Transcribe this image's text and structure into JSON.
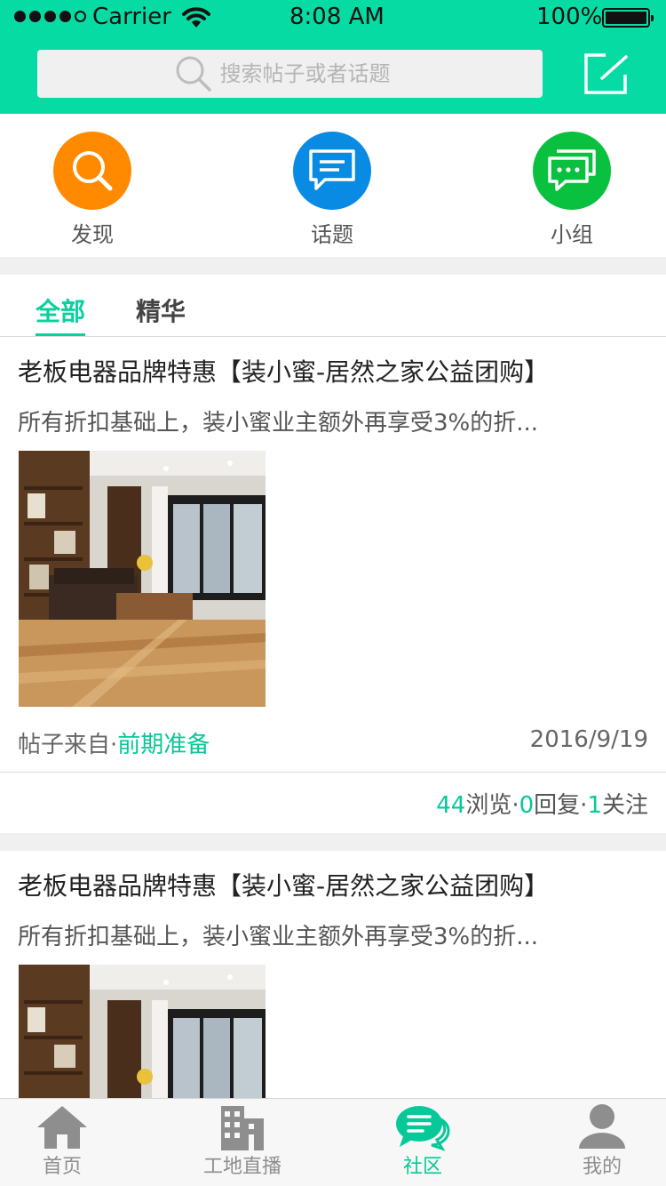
{
  "status_bar": {
    "carrier": "Carrier",
    "time": "8:08 AM",
    "battery": "100%"
  },
  "search": {
    "placeholder": "搜索帖子或者话题"
  },
  "categories": [
    {
      "label": "发现",
      "color": "#ff8a00",
      "icon": "search-icon"
    },
    {
      "label": "话题",
      "color": "#0a8be3",
      "icon": "message-icon"
    },
    {
      "label": "小组",
      "color": "#0ac13f",
      "icon": "chat-group-icon"
    }
  ],
  "tabs": [
    {
      "label": "全部",
      "active": true
    },
    {
      "label": "精华",
      "active": false
    }
  ],
  "posts": [
    {
      "title": "老板电器品牌特惠【装小蜜-居然之家公益团购】",
      "summary": "所有折扣基础上，装小蜜业主额外再享受3%的折...",
      "source_prefix": "帖子来自·",
      "source_tag": "前期准备",
      "date": "2016/9/19",
      "views": "44",
      "views_label": "浏览·",
      "replies": "0",
      "replies_label": "回复·",
      "follows": "1",
      "follows_label": "关注"
    },
    {
      "title": "老板电器品牌特惠【装小蜜-居然之家公益团购】",
      "summary": "所有折扣基础上，装小蜜业主额外再享受3%的折..."
    }
  ],
  "tabbar": [
    {
      "label": "首页",
      "icon": "home-icon",
      "active": false
    },
    {
      "label": "工地直播",
      "icon": "building-icon",
      "active": false
    },
    {
      "label": "社区",
      "icon": "community-chat-icon",
      "active": true
    },
    {
      "label": "我的",
      "icon": "user-icon",
      "active": false
    }
  ],
  "colors": {
    "brand": "#07dba4",
    "accent_text": "#07c898",
    "tab_inactive": "#8e8e8e"
  }
}
